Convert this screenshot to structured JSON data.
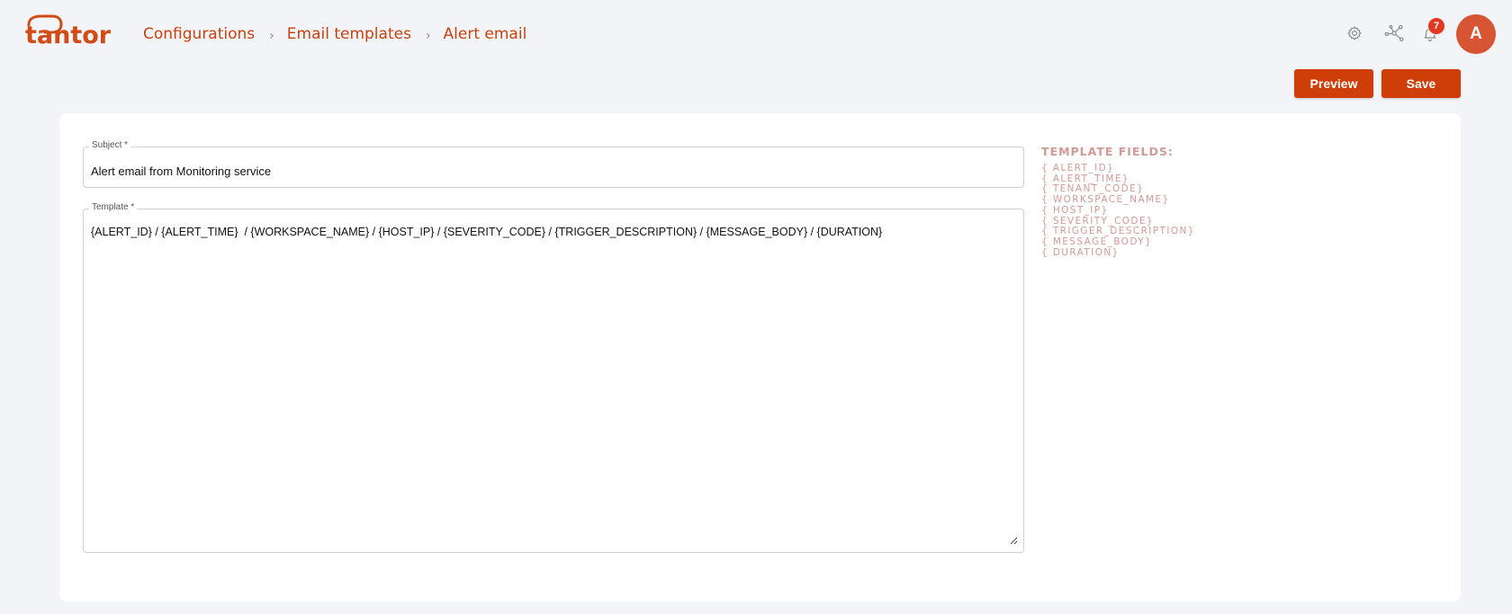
{
  "brand": {
    "name": "tantor",
    "color": "#d24a14"
  },
  "breadcrumb": [
    {
      "label": "Configurations"
    },
    {
      "label": "Email templates"
    },
    {
      "label": "Alert email"
    }
  ],
  "header": {
    "icons": [
      "gear-icon",
      "network-icon",
      "bell-icon"
    ],
    "notifications_count": "7",
    "avatar_initial": "A"
  },
  "actions": {
    "preview_label": "Preview",
    "save_label": "Save",
    "accent": "#cf3e09"
  },
  "form": {
    "subject_label": "Subject *",
    "subject_value": "Alert email from Monitoring service",
    "template_label": "Template *",
    "template_value": "{ALERT_ID} / {ALERT_TIME}  / {WORKSPACE_NAME} / {HOST_IP} / {SEVERITY_CODE} / {TRIGGER_DESCRIPTION} / {MESSAGE_BODY} / {DURATION}"
  },
  "template_fields": {
    "title": "TEMPLATE FIELDS:",
    "items": [
      "{ ALERT_ID}",
      "{ ALERT_TIME}",
      "{ TENANT_CODE}",
      "{ WORKSPACE_NAME}",
      "{ HOST_IP}",
      "{ SEVERITY_CODE}",
      "{ TRIGGER_DESCRIPTION}",
      "{ MESSAGE_BODY}",
      "{ DURATION}"
    ],
    "color": "#d19a97"
  }
}
